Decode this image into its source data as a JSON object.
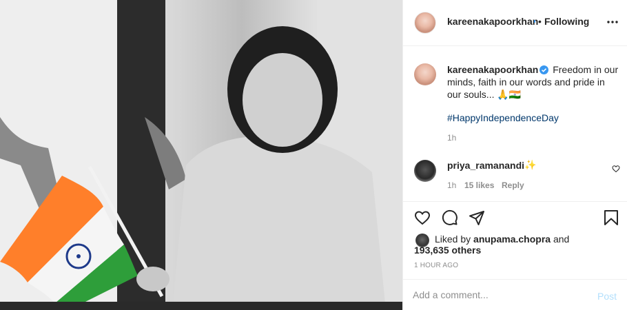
{
  "post": {
    "author": "kareenakapoorkhan",
    "follow_dot": "•",
    "follow_status": "Following",
    "more_icon": "more-horizontal-icon"
  },
  "caption": {
    "username": "kareenakapoorkhan",
    "text": "Freedom in our minds, faith in our words and pride in our souls...",
    "emoji": "🙏🇮🇳",
    "hashtag": "#HappyIndependenceDay",
    "time": "1h"
  },
  "comment": {
    "username": "priya_ramanandi",
    "text": "✨",
    "time": "1h",
    "likes": "15 likes",
    "reply": "Reply"
  },
  "actions": {
    "like_icon": "heart-icon",
    "comment_icon": "comment-icon",
    "share_icon": "share-icon",
    "save_icon": "bookmark-icon"
  },
  "likes": {
    "prefix": "Liked by",
    "user": "anupama.chopra",
    "and": "and",
    "others": "193,635 others"
  },
  "timestamp": "1 HOUR AGO",
  "add_comment": {
    "placeholder": "Add a comment...",
    "post_label": "Post"
  },
  "colors": {
    "link": "#00376b",
    "muted": "#8e8e8e",
    "post_disabled": "#b2dffc",
    "verified": "#3897f0",
    "flag_saffron": "#ff7f2a",
    "flag_green": "#2e9e3a",
    "flag_navy": "#1e3a8a"
  }
}
